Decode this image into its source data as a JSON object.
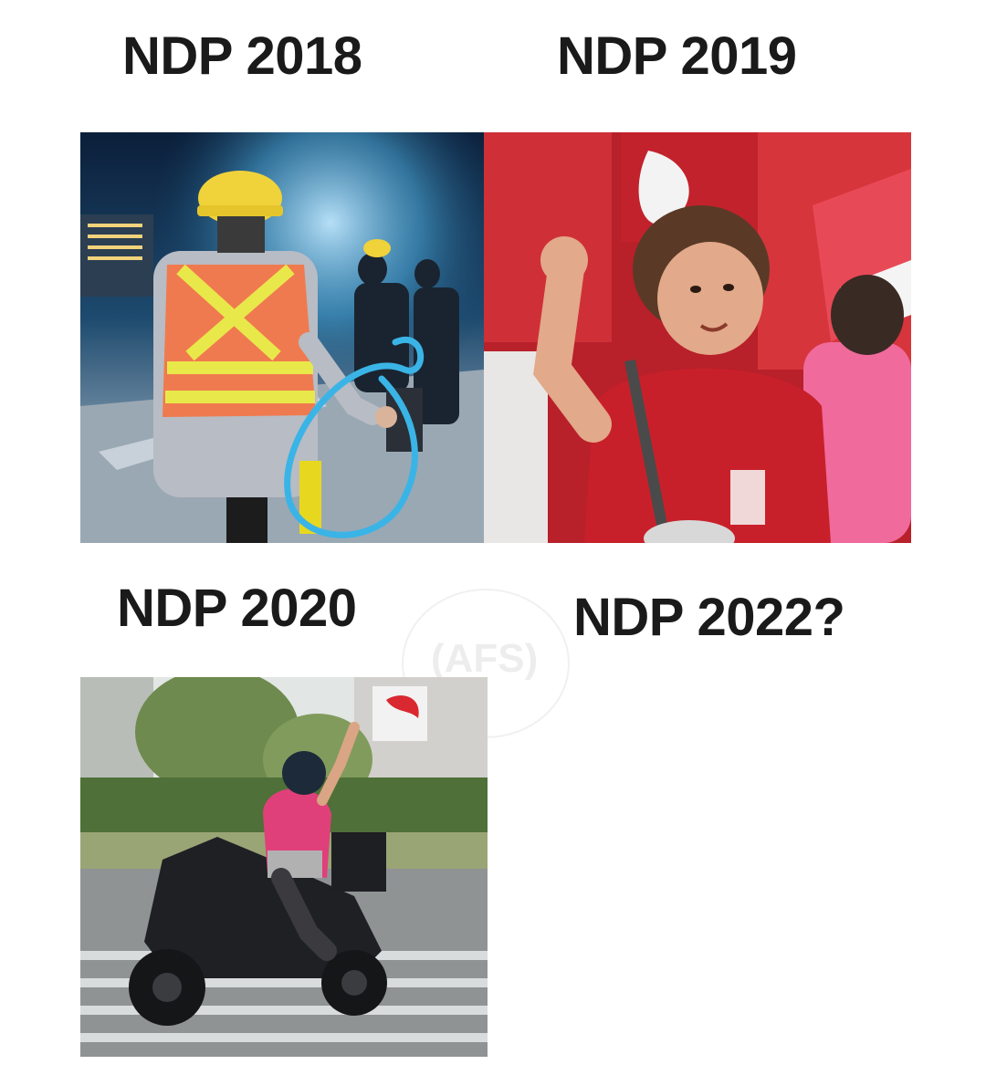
{
  "captions": {
    "top_left": "NDP 2018",
    "top_right": "NDP 2019",
    "bottom_left": "NDP 2020",
    "bottom_right": "NDP 2022?"
  },
  "panels": {
    "ndp_2018": "photo-worker-in-hi-vis-vest",
    "ndp_2019": "photo-woman-in-red-shirt-in-crowd",
    "ndp_2020": "photo-delivery-rider-on-scooter"
  },
  "watermark_text": "(AFS)",
  "colors": {
    "caption_text": "#1a1a1a",
    "highlight_circle": "#3ab4e6",
    "vest_orange": "#f07a4f",
    "vest_stripe": "#e8e84a",
    "shirt_red": "#c8202a",
    "rider_pink": "#e0407a"
  }
}
